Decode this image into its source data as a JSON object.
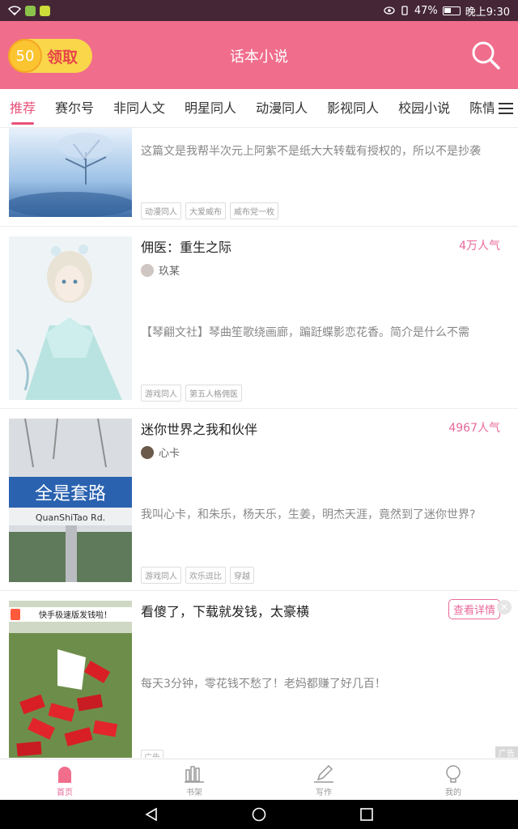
{
  "status_bar": {
    "battery_percent": "47%",
    "time": "晚上9:30"
  },
  "header": {
    "reward_amount": "50",
    "reward_label": "领取",
    "title": "话本小说",
    "search_icon": "search-icon"
  },
  "tabs": [
    "推荐",
    "赛尔号",
    "非同人文",
    "明星同人",
    "动漫同人",
    "影视同人",
    "校园小说",
    "陈情"
  ],
  "active_tab": "推荐",
  "books": [
    {
      "title": "",
      "popularity": "",
      "author": "",
      "description": "这篇文是我帮半次元上阿紫不是纸大大转载有授权的，所以不是抄袭",
      "tags": [
        "动漫同人",
        "大爱威布",
        "威布党一枚"
      ]
    },
    {
      "title": "佣医：重生之际",
      "popularity": "4万人气",
      "author": "玖某",
      "description": "【琴翩文社】琴曲笙歌绕画廊，蹁跹蝶影恋花香。简介是什么不需",
      "tags": [
        "游戏同人",
        "第五人格佣医"
      ]
    },
    {
      "title": "迷你世界之我和伙伴",
      "popularity": "4967人气",
      "author": "心卡",
      "description": "我叫心卡，和朱乐，杨天乐，生姜，明杰天涯，竟然到了迷你世界?",
      "tags": [
        "游戏同人",
        "欢乐逗比",
        "穿越"
      ],
      "cover_sign_text": "全是套路",
      "cover_sign_sub": "QuanShiTao Rd."
    }
  ],
  "ad": {
    "title": "看傻了，下载就发钱，太豪横",
    "description": "每天3分钟，零花钱不愁了！老妈都赚了好几百！",
    "button_label": "查看详情",
    "ad_label": "广告",
    "corner_label": "广告",
    "cover_banner": "快手极速版发钱啦！"
  },
  "bottom_nav": [
    {
      "label": "首页",
      "icon": "home-icon",
      "active": true
    },
    {
      "label": "书架",
      "icon": "bookshelf-icon",
      "active": false
    },
    {
      "label": "写作",
      "icon": "pen-icon",
      "active": false
    },
    {
      "label": "我的",
      "icon": "profile-icon",
      "active": false
    }
  ],
  "colors": {
    "accent": "#e8527a",
    "header": "#f06d8c",
    "status_bar": "#452636"
  }
}
